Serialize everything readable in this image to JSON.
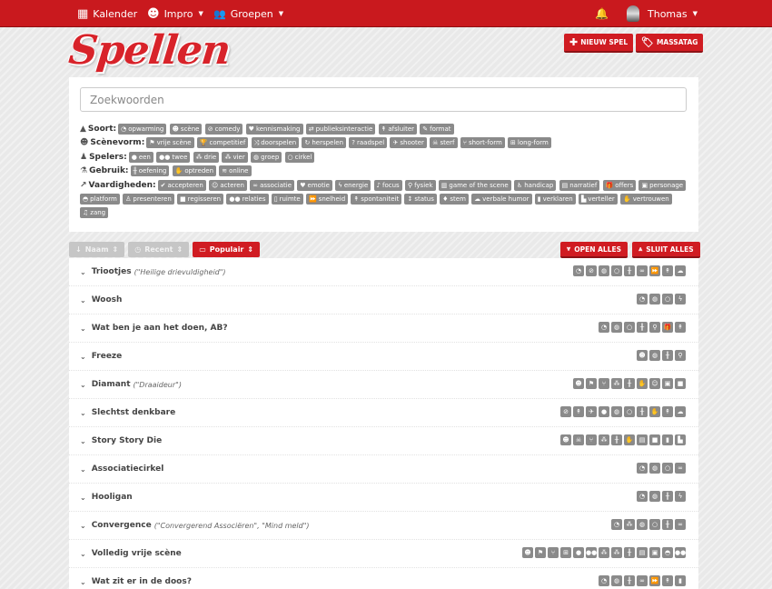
{
  "navbar": {
    "items": [
      {
        "icon": "calendar-icon",
        "glyph": "▦",
        "label": "Kalender"
      },
      {
        "icon": "masks-icon",
        "glyph": "☻",
        "label": "Impro",
        "dropdown": true
      },
      {
        "icon": "users-icon",
        "glyph": "👥",
        "label": "Groepen",
        "dropdown": true
      }
    ],
    "bell_glyph": "🔔",
    "user": "Thomas"
  },
  "page": {
    "title": "Spellen",
    "new_game_label": "NIEUW SPEL",
    "masstag_label": "MASSATAG"
  },
  "search": {
    "placeholder": "Zoekwoorden",
    "value": ""
  },
  "filters": [
    {
      "label": "Soort:",
      "glyph": "▲",
      "tags": [
        {
          "g": "◔",
          "t": "opwarming"
        },
        {
          "g": "☻",
          "t": "scène"
        },
        {
          "g": "⊘",
          "t": "comedy"
        },
        {
          "g": "♥",
          "t": "kennismaking"
        },
        {
          "g": "⇄",
          "t": "publieksinteractie"
        },
        {
          "g": "↟",
          "t": "afsluiter"
        },
        {
          "g": "✎",
          "t": "format"
        }
      ]
    },
    {
      "label": "Scènevorm:",
      "glyph": "☻",
      "tags": [
        {
          "g": "⚑",
          "t": "vrije scène"
        },
        {
          "g": "🏆",
          "t": "competitief"
        },
        {
          "g": "⤨",
          "t": "doorspelen"
        },
        {
          "g": "↻",
          "t": "herspelen"
        },
        {
          "g": "?",
          "t": "raadspel"
        },
        {
          "g": "✈",
          "t": "shooter"
        },
        {
          "g": "☠",
          "t": "sterf"
        },
        {
          "g": "⑂",
          "t": "short-form"
        },
        {
          "g": "⊞",
          "t": "long-form"
        }
      ]
    },
    {
      "label": "Spelers:",
      "glyph": "♟",
      "tags": [
        {
          "g": "●",
          "t": "een"
        },
        {
          "g": "●●",
          "t": "twee"
        },
        {
          "g": "⁂",
          "t": "drie"
        },
        {
          "g": "⁂",
          "t": "vier"
        },
        {
          "g": "◍",
          "t": "groep"
        },
        {
          "g": "○",
          "t": "cirkel"
        }
      ]
    },
    {
      "label": "Gebruik:",
      "glyph": "⚗",
      "tags": [
        {
          "g": "╫",
          "t": "oefening"
        },
        {
          "g": "✋",
          "t": "optreden"
        },
        {
          "g": "≋",
          "t": "online"
        }
      ]
    },
    {
      "label": "Vaardigheden:",
      "glyph": "↗",
      "tags": [
        {
          "g": "✔",
          "t": "accepteren"
        },
        {
          "g": "☺",
          "t": "acteren"
        },
        {
          "g": "∞",
          "t": "associatie"
        },
        {
          "g": "♥",
          "t": "emotie"
        },
        {
          "g": "ϟ",
          "t": "energie"
        },
        {
          "g": "♪",
          "t": "focus"
        },
        {
          "g": "⚲",
          "t": "fysiek"
        },
        {
          "g": "▥",
          "t": "game of the scene"
        },
        {
          "g": "♿",
          "t": "handicap"
        },
        {
          "g": "▤",
          "t": "narratief"
        },
        {
          "g": "🎁",
          "t": "offers"
        },
        {
          "g": "▣",
          "t": "personage"
        },
        {
          "g": "◓",
          "t": "platform"
        },
        {
          "g": "♙",
          "t": "presenteren"
        },
        {
          "g": "■",
          "t": "regisseren"
        },
        {
          "g": "●●",
          "t": "relaties"
        },
        {
          "g": "▯",
          "t": "ruimte"
        },
        {
          "g": "⏩",
          "t": "snelheid"
        },
        {
          "g": "↟",
          "t": "spontaniteit"
        },
        {
          "g": "↕",
          "t": "status"
        },
        {
          "g": "♦",
          "t": "stem"
        },
        {
          "g": "☁",
          "t": "verbale humor"
        },
        {
          "g": "▮",
          "t": "verklaren"
        },
        {
          "g": "▙",
          "t": "verteller"
        },
        {
          "g": "✋",
          "t": "vertrouwen"
        },
        {
          "g": "♫",
          "t": "zang"
        }
      ]
    }
  ],
  "sorting": {
    "options": [
      {
        "glyph": "↓",
        "label": "Naam",
        "active": false
      },
      {
        "glyph": "◷",
        "label": "Recent",
        "active": false
      },
      {
        "glyph": "▭",
        "label": "Populair",
        "active": true
      }
    ],
    "sort_glyph": "⇕",
    "open_all_label": "OPEN ALLES",
    "close_all_label": "SLUIT ALLES"
  },
  "games": [
    {
      "name": "Triootjes",
      "alias": "(\"Heilige drievuldigheid\")",
      "icons": [
        "◔",
        "⊘",
        "◍",
        "○",
        "╫",
        "∞",
        "⏩",
        "↟",
        "☁"
      ]
    },
    {
      "name": "Woosh",
      "alias": "",
      "icons": [
        "◔",
        "◍",
        "○",
        "ϟ"
      ]
    },
    {
      "name": "Wat ben je aan het doen, AB?",
      "alias": "",
      "icons": [
        "◔",
        "◍",
        "○",
        "╫",
        "⚲",
        "🎁",
        "↟"
      ]
    },
    {
      "name": "Freeze",
      "alias": "",
      "icons": [
        "☻",
        "◍",
        "╫",
        "⚲"
      ]
    },
    {
      "name": "Diamant",
      "alias": "(\"Draaideur\")",
      "icons": [
        "☻",
        "⚑",
        "⑂",
        "⁂",
        "╫",
        "✋",
        "☺",
        "▣",
        "■"
      ]
    },
    {
      "name": "Slechtst denkbare",
      "alias": "",
      "icons": [
        "⊘",
        "↟",
        "✈",
        "●",
        "◍",
        "○",
        "╫",
        "✋",
        "↟",
        "☁"
      ]
    },
    {
      "name": "Story Story Die",
      "alias": "",
      "icons": [
        "☻",
        "☠",
        "⑂",
        "⁂",
        "╫",
        "✋",
        "▤",
        "■",
        "▮",
        "▙"
      ]
    },
    {
      "name": "Associatiecirkel",
      "alias": "",
      "icons": [
        "◔",
        "◍",
        "○",
        "∞"
      ]
    },
    {
      "name": "Hooligan",
      "alias": "",
      "icons": [
        "◔",
        "◍",
        "╫",
        "ϟ"
      ]
    },
    {
      "name": "Convergence",
      "alias": "(\"Convergerend Associëren\", \"Mind meld\")",
      "icons": [
        "◔",
        "⁂",
        "◍",
        "○",
        "╫",
        "∞"
      ]
    },
    {
      "name": "Volledig vrije scène",
      "alias": "",
      "icons": [
        "☻",
        "⚑",
        "⑂",
        "⊞",
        "●",
        "●●",
        "⁂",
        "⁂",
        "╫",
        "▤",
        "▣",
        "◓",
        "●●"
      ]
    },
    {
      "name": "Wat zit er in de doos?",
      "alias": "",
      "icons": [
        "◔",
        "◍",
        "╫",
        "∞",
        "⏩",
        "↟",
        "▮"
      ]
    }
  ]
}
